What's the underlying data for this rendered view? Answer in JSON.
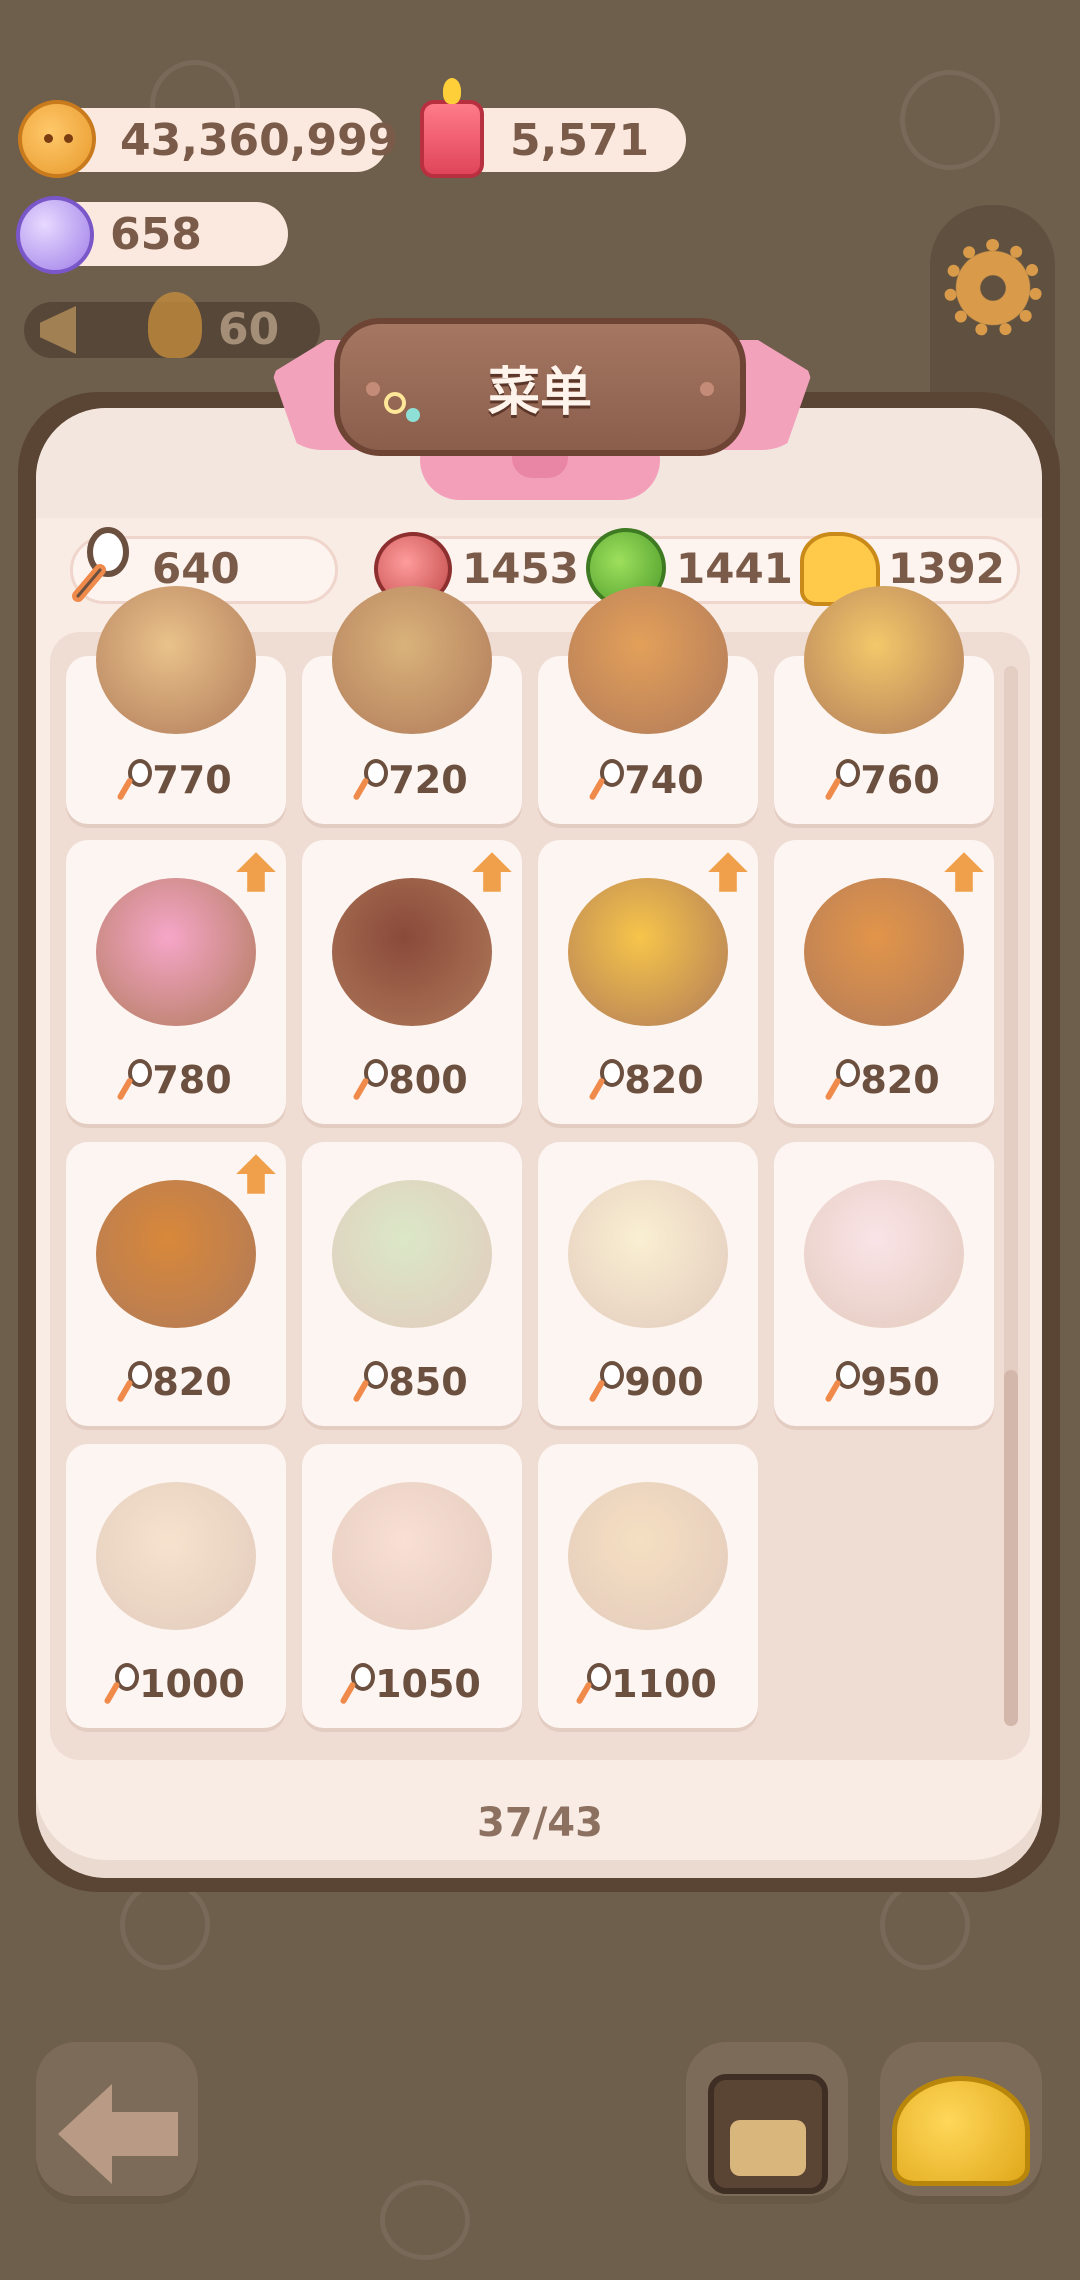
{
  "currencies": {
    "cookies": "43,360,999",
    "candles": "5,571",
    "gems": "658",
    "ticker_count": "60"
  },
  "menu": {
    "title": "菜单",
    "spoon_total": "640",
    "ingredients": [
      {
        "icon": "meat-icon",
        "value": "1453"
      },
      {
        "icon": "broccoli-icon",
        "value": "1441"
      },
      {
        "icon": "cheese-icon",
        "value": "1392"
      }
    ],
    "dishes": [
      {
        "price": "770",
        "upgradable": false,
        "locked": false,
        "color": "#e9c28a"
      },
      {
        "price": "720",
        "upgradable": false,
        "locked": false,
        "color": "#d9b27a"
      },
      {
        "price": "740",
        "upgradable": false,
        "locked": false,
        "color": "#e3a05a"
      },
      {
        "price": "760",
        "upgradable": false,
        "locked": false,
        "color": "#f2c86a"
      },
      {
        "price": "780",
        "upgradable": true,
        "locked": false,
        "color": "#f6a6c8"
      },
      {
        "price": "800",
        "upgradable": true,
        "locked": false,
        "color": "#8a4a3a"
      },
      {
        "price": "820",
        "upgradable": true,
        "locked": false,
        "color": "#f6c54a"
      },
      {
        "price": "820",
        "upgradable": true,
        "locked": false,
        "color": "#e2954a"
      },
      {
        "price": "820",
        "upgradable": true,
        "locked": false,
        "color": "#d8883a"
      },
      {
        "price": "850",
        "upgradable": false,
        "locked": true,
        "color": "#9bcf7a"
      },
      {
        "price": "900",
        "upgradable": false,
        "locked": true,
        "color": "#f4e39a"
      },
      {
        "price": "950",
        "upgradable": false,
        "locked": true,
        "color": "#f7c3d5"
      },
      {
        "price": "1000",
        "upgradable": false,
        "locked": true,
        "color": "#e9c08a"
      },
      {
        "price": "1050",
        "upgradable": false,
        "locked": true,
        "color": "#f2b8a0"
      },
      {
        "price": "1100",
        "upgradable": false,
        "locked": true,
        "color": "#e7b86a"
      }
    ],
    "progress": "37/43"
  }
}
